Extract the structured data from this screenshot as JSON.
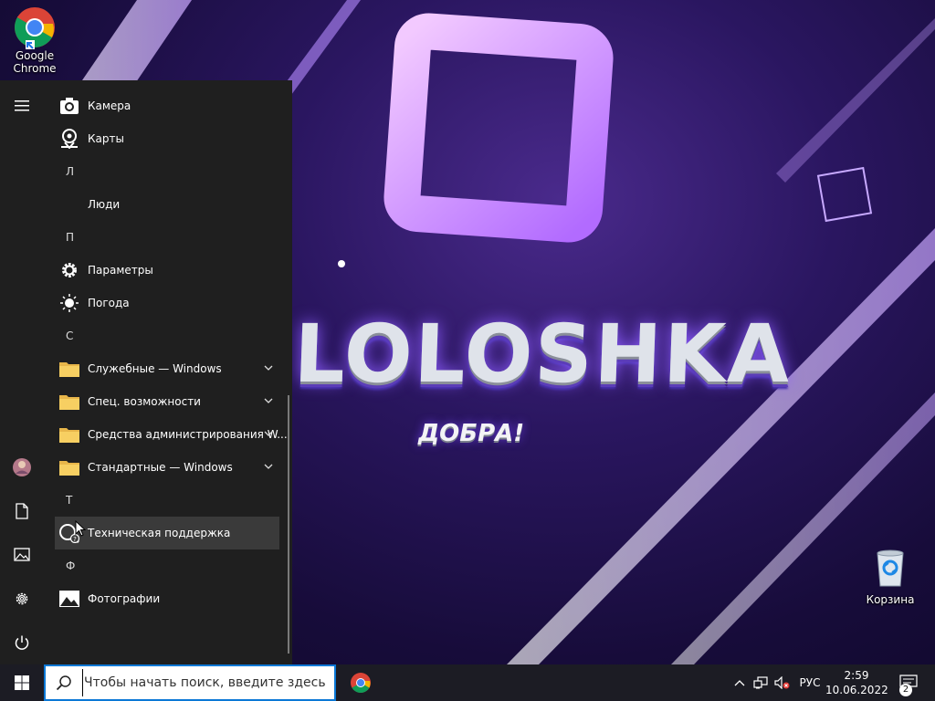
{
  "desktop": {
    "icons": [
      {
        "label": "Google\nChrome",
        "icon": "chrome-icon"
      },
      {
        "label": "Корзина",
        "icon": "recycle-bin-icon"
      }
    ],
    "wallpaper": {
      "logo_text": "LOLOSHKA",
      "subtitle": "ДОБРА!",
      "colors": {
        "purple": "#8d5cff",
        "deep": "#170c3a",
        "accent": "#d9b8ff"
      }
    }
  },
  "start_menu": {
    "rail": [
      {
        "name": "hamburger-menu-icon"
      },
      {
        "name": "user-avatar"
      },
      {
        "name": "documents-icon"
      },
      {
        "name": "pictures-icon"
      },
      {
        "name": "settings-icon"
      },
      {
        "name": "power-icon"
      }
    ],
    "apps": [
      {
        "kind": "app",
        "label": "Камера",
        "icon": "camera-icon"
      },
      {
        "kind": "app",
        "label": "Карты",
        "icon": "maps-icon"
      },
      {
        "kind": "letter",
        "label": "Л"
      },
      {
        "kind": "app",
        "label": "Люди",
        "icon": "people-icon"
      },
      {
        "kind": "letter",
        "label": "П"
      },
      {
        "kind": "app",
        "label": "Параметры",
        "icon": "gear-icon"
      },
      {
        "kind": "app",
        "label": "Погода",
        "icon": "weather-sun-icon"
      },
      {
        "kind": "letter",
        "label": "С"
      },
      {
        "kind": "folder",
        "label": "Служебные — Windows",
        "icon": "folder-icon"
      },
      {
        "kind": "folder",
        "label": "Спец. возможности",
        "icon": "folder-icon"
      },
      {
        "kind": "folder",
        "label": "Средства администрирования W...",
        "icon": "folder-icon"
      },
      {
        "kind": "folder",
        "label": "Стандартные — Windows",
        "icon": "folder-icon"
      },
      {
        "kind": "letter",
        "label": "Т"
      },
      {
        "kind": "app",
        "label": "Техническая поддержка",
        "icon": "support-icon",
        "hover": true
      },
      {
        "kind": "letter",
        "label": "Ф"
      },
      {
        "kind": "app",
        "label": "Фотографии",
        "icon": "photos-icon"
      }
    ]
  },
  "taskbar": {
    "search_placeholder": "Чтобы начать поиск, введите здесь зап",
    "tray": {
      "language": "РУС",
      "time": "2:59",
      "date": "10.06.2022",
      "notifications": "2"
    },
    "accent": "#0b78d6"
  }
}
